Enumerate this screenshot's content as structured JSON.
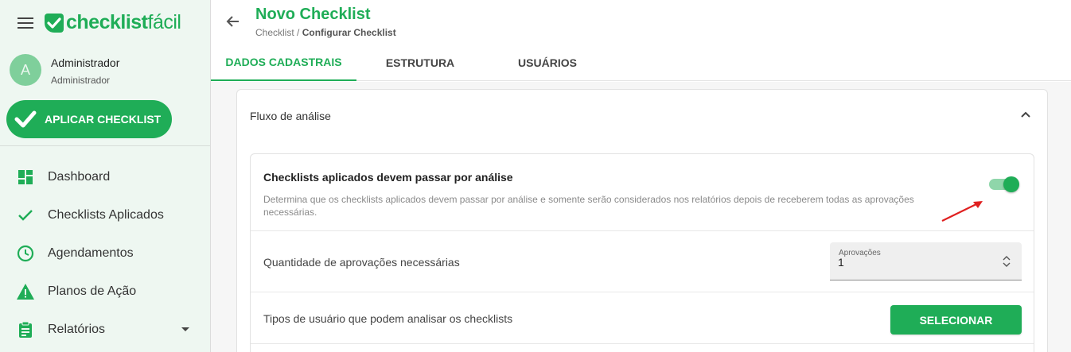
{
  "sidebar": {
    "logo": {
      "bold": "checklist",
      "light": "fácil"
    },
    "user": {
      "avatar_initial": "A",
      "name": "Administrador",
      "role": "Administrador"
    },
    "apply_button": "APLICAR CHECKLIST",
    "items": [
      {
        "label": "Dashboard",
        "icon": "dashboard-icon"
      },
      {
        "label": "Checklists Aplicados",
        "icon": "check-icon"
      },
      {
        "label": "Agendamentos",
        "icon": "clock-icon"
      },
      {
        "label": "Planos de Ação",
        "icon": "warning-icon"
      },
      {
        "label": "Relatórios",
        "icon": "clipboard-icon"
      }
    ]
  },
  "header": {
    "title": "Novo Checklist",
    "breadcrumb_root": "Checklist",
    "breadcrumb_separator": " / ",
    "breadcrumb_current": "Configurar Checklist"
  },
  "tabs": [
    {
      "label": "DADOS CADASTRAIS",
      "active": true
    },
    {
      "label": "ESTRUTURA",
      "active": false
    },
    {
      "label": "USUÁRIOS",
      "active": false
    }
  ],
  "panel": {
    "title": "Fluxo de análise",
    "setting": {
      "title": "Checklists aplicados devem passar por análise",
      "description": "Determina que os checklists aplicados devem passar por análise e somente serão considerados nos relatórios depois de receberem todas as aprovações necessárias.",
      "enabled": true
    },
    "approvals": {
      "label": "Quantidade de aprovações necessárias",
      "field_label": "Aprovações",
      "value": "1"
    },
    "user_types": {
      "label": "Tipos de usuário que podem analisar os checklists",
      "button": "SELECIONAR"
    }
  },
  "colors": {
    "accent": "#1fad57",
    "sidebar_bg": "#eef7f1",
    "annotation_arrow": "#e02020"
  }
}
